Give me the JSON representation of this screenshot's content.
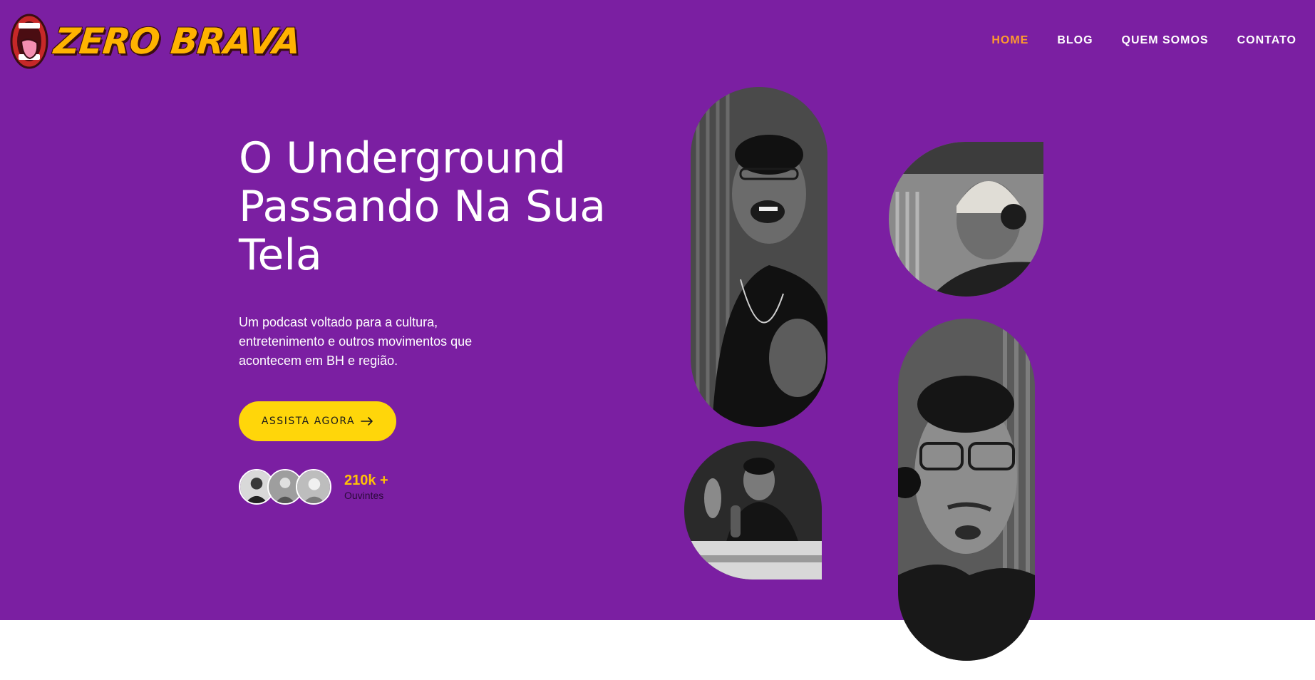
{
  "brand": {
    "name": "ZERO BRAVA",
    "logo_icon": "mouth-tongue-icon",
    "colors": {
      "background": "#7b1fa2",
      "accent": "#ffd60a",
      "nav_active": "#ff9a2e",
      "stat": "#ffc107"
    }
  },
  "nav": {
    "items": [
      {
        "label": "HOME",
        "active": true
      },
      {
        "label": "BLOG",
        "active": false
      },
      {
        "label": "QUEM SOMOS",
        "active": false
      },
      {
        "label": "CONTATO",
        "active": false
      }
    ]
  },
  "hero": {
    "title_lines": [
      "O Underground",
      "Passando Na Sua",
      "Tela"
    ],
    "description": "Um podcast voltado para a cultura, entretenimento e outros movimentos que acontecem em BH e região.",
    "cta_label": "ASSISTA AGORA",
    "cta_icon": "arrow-right-icon"
  },
  "listeners": {
    "value": "210k +",
    "label": "Ouvintes"
  }
}
